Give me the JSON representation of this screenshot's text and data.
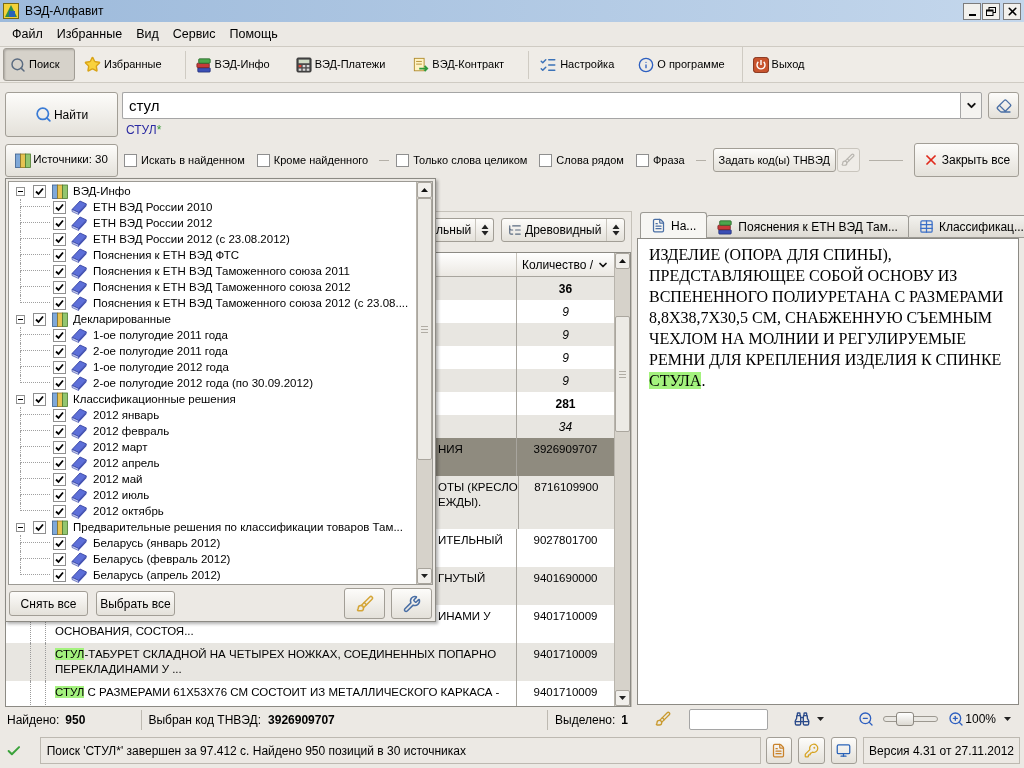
{
  "window": {
    "title": "ВЭД-Алфавит"
  },
  "menu": [
    "Файл",
    "Избранные",
    "Вид",
    "Сервис",
    "Помощь"
  ],
  "toolbar": {
    "groups": [
      [
        {
          "label": "Поиск",
          "selected": true
        },
        {
          "label": "Избранные",
          "selected": false
        }
      ],
      [
        {
          "label": "ВЭД-Инфо",
          "selected": false
        },
        {
          "label": "ВЭД-Платежи",
          "selected": false
        },
        {
          "label": "ВЭД-Контракт",
          "selected": false
        }
      ],
      [
        {
          "label": "Настройка",
          "selected": false
        },
        {
          "label": "О программе",
          "selected": false
        }
      ],
      [
        {
          "label": "Выход",
          "selected": false
        }
      ]
    ]
  },
  "search": {
    "find_button": "Найти",
    "query": "стул",
    "parsed_query": "СТУЛ",
    "wildcard": "*",
    "sources_button": "Источники: 30",
    "options": [
      {
        "label": "Искать в найденном",
        "checked": false
      },
      {
        "label": "Кроме найденного",
        "checked": false
      },
      {
        "label": "Только слова целиком",
        "checked": false
      },
      {
        "label": "Слова рядом",
        "checked": false
      },
      {
        "label": "Фраза",
        "checked": false
      }
    ],
    "code_button": "Задать код(ы) ТНВЭД",
    "clear_code_button": {
      "disabled": true
    },
    "close_all_button": "Закрыть все"
  },
  "sources_popup": {
    "tree": [
      {
        "label": "ВЭД-Инфо",
        "checked": true,
        "expanded": true,
        "children": [
          {
            "label": "ЕТН ВЭД России 2010",
            "checked": true
          },
          {
            "label": "ЕТН ВЭД России 2012",
            "checked": true
          },
          {
            "label": "ЕТН ВЭД России 2012 (с 23.08.2012)",
            "checked": true
          },
          {
            "label": "Пояснения к ЕТН ВЭД ФТС",
            "checked": true
          },
          {
            "label": "Пояснения к ЕТН ВЭД Таможенного союза 2011",
            "checked": true
          },
          {
            "label": "Пояснения к ЕТН ВЭД Таможенного союза 2012",
            "checked": true
          },
          {
            "label": "Пояснения к ЕТН ВЭД Таможенного союза 2012 (с 23.08....",
            "checked": true
          }
        ]
      },
      {
        "label": "Декларированные",
        "checked": true,
        "expanded": true,
        "children": [
          {
            "label": "1-ое полугодие 2011 года",
            "checked": true
          },
          {
            "label": "2-ое полугодие 2011 года",
            "checked": true
          },
          {
            "label": "1-ое полугодие 2012 года",
            "checked": true
          },
          {
            "label": "2-ое полугодие 2012 года (по 30.09.2012)",
            "checked": true
          }
        ]
      },
      {
        "label": "Классификационные решения",
        "checked": true,
        "expanded": true,
        "children": [
          {
            "label": "2012 январь",
            "checked": true
          },
          {
            "label": "2012 февраль",
            "checked": true
          },
          {
            "label": "2012 март",
            "checked": true
          },
          {
            "label": "2012 апрель",
            "checked": true
          },
          {
            "label": "2012 май",
            "checked": true
          },
          {
            "label": "2012 июль",
            "checked": true
          },
          {
            "label": "2012 октябрь",
            "checked": true
          }
        ]
      },
      {
        "label": "Предварительные решения по классификации товаров Там...",
        "checked": true,
        "expanded": true,
        "children": [
          {
            "label": "Беларусь (январь 2012)",
            "checked": true
          },
          {
            "label": "Беларусь (февраль 2012)",
            "checked": true
          },
          {
            "label": "Беларусь (апрель 2012)",
            "checked": true
          }
        ]
      }
    ],
    "buttons": [
      "Снять все",
      "Выбрать все"
    ]
  },
  "results": {
    "view_selectors": [
      "льный",
      "Древовидный"
    ],
    "columns": [
      {
        "label": "Количество /"
      }
    ],
    "rows": [
      {
        "kind": "group",
        "count": "36",
        "selected": false
      },
      {
        "kind": "source",
        "count": "9",
        "selected": false
      },
      {
        "kind": "source",
        "count": "9",
        "selected": false
      },
      {
        "kind": "source",
        "count": "9",
        "selected": false
      },
      {
        "kind": "source",
        "count": "9",
        "selected": false
      },
      {
        "kind": "group",
        "count": "281",
        "selected": false
      },
      {
        "kind": "source",
        "count": "34",
        "selected": false
      },
      {
        "kind": "item",
        "selected": true,
        "code": "3926909707",
        "covered_lines": [
          "НИЯ"
        ]
      },
      {
        "kind": "item",
        "selected": false,
        "code": "8716109900",
        "covered_lines": [
          "ОТЫ (КРЕСЛО",
          "ЕЖДЫ)."
        ]
      },
      {
        "kind": "item",
        "selected": false,
        "code": "9027801700",
        "covered_lines": [
          "ИТЕЛЬНЫЙ"
        ]
      },
      {
        "kind": "item",
        "selected": false,
        "code": "9401690000",
        "covered_lines": [
          "ГНУТЫЙ"
        ]
      },
      {
        "kind": "item",
        "selected": false,
        "code": "9401710009",
        "covered_lines": [
          "ИНАМИ У"
        ],
        "lines": [
          [
            {
              "text": "ОСНОВАНИЯ, СОСТОЯ...",
              "highlight": false
            }
          ]
        ]
      },
      {
        "kind": "item",
        "selected": false,
        "code": "9401710009",
        "lines": [
          [
            {
              "text": "СТУЛ",
              "highlight": true
            },
            {
              "text": "-ТАБУРЕТ СКЛАДНОЙ НА ЧЕТЫРЕХ НОЖКАХ, СОЕДИНЕННЫХ ПОПАРНО",
              "highlight": false
            }
          ],
          [
            {
              "text": "ПЕРЕКЛАДИНАМИ У ...",
              "highlight": false
            }
          ]
        ]
      },
      {
        "kind": "item",
        "selected": false,
        "code": "9401710009",
        "lines": [
          [
            {
              "text": "СТУЛ",
              "highlight": true
            },
            {
              "text": " С РАЗМЕРАМИ 61Х53Х76 СМ СОСТОИТ ИЗ МЕТАЛЛИЧЕСКОГО КАРКАСА -",
              "highlight": false
            }
          ]
        ]
      }
    ],
    "status": {
      "found_label": "Найдено:",
      "found_value": "950",
      "code_label": "Выбран код ТНВЭД:",
      "code_value": "3926909707",
      "marked_label": "Выделено:",
      "marked_value": "1"
    }
  },
  "document": {
    "tabs": [
      {
        "label": "На...",
        "selected": true
      },
      {
        "label": "Пояснения к ЕТН ВЭД Там...",
        "selected": false
      },
      {
        "label": "Классификац...",
        "selected": false
      }
    ],
    "lines": [
      [
        {
          "text": "ИЗДЕЛИЕ (ОПОРА ДЛЯ СПИНЫ),",
          "highlight": false
        }
      ],
      [
        {
          "text": "ПРЕДСТАВЛЯЮЩЕЕ СОБОЙ ОСНОВУ ИЗ",
          "highlight": false
        }
      ],
      [
        {
          "text": "ВСПЕНЕННОГО ПОЛИУРЕТАНА С РАЗМЕРАМИ",
          "highlight": false
        }
      ],
      [
        {
          "text": "8,8Х38,7Х30,5 СМ, СНАБЖЕННУЮ СЪЕМНЫМ",
          "highlight": false
        }
      ],
      [
        {
          "text": "ЧЕХЛОМ НА МОЛНИИ И РЕГУЛИРУЕМЫЕ",
          "highlight": false
        }
      ],
      [
        {
          "text": "РЕМНИ ДЛЯ КРЕПЛЕНИЯ ИЗДЕЛИЯ К СПИНКЕ",
          "highlight": false
        }
      ],
      [
        {
          "text": "СТУЛА",
          "highlight": true
        },
        {
          "text": ".",
          "highlight": false
        }
      ]
    ],
    "zoom": {
      "level": 0.4,
      "value": "100%"
    }
  },
  "status_bar": {
    "message": "Поиск 'СТУЛ*' завершен за 97.412 с. Найдено 950 позиций в 30 источниках",
    "version": "Версия 4.31 от 27.11.2012"
  }
}
